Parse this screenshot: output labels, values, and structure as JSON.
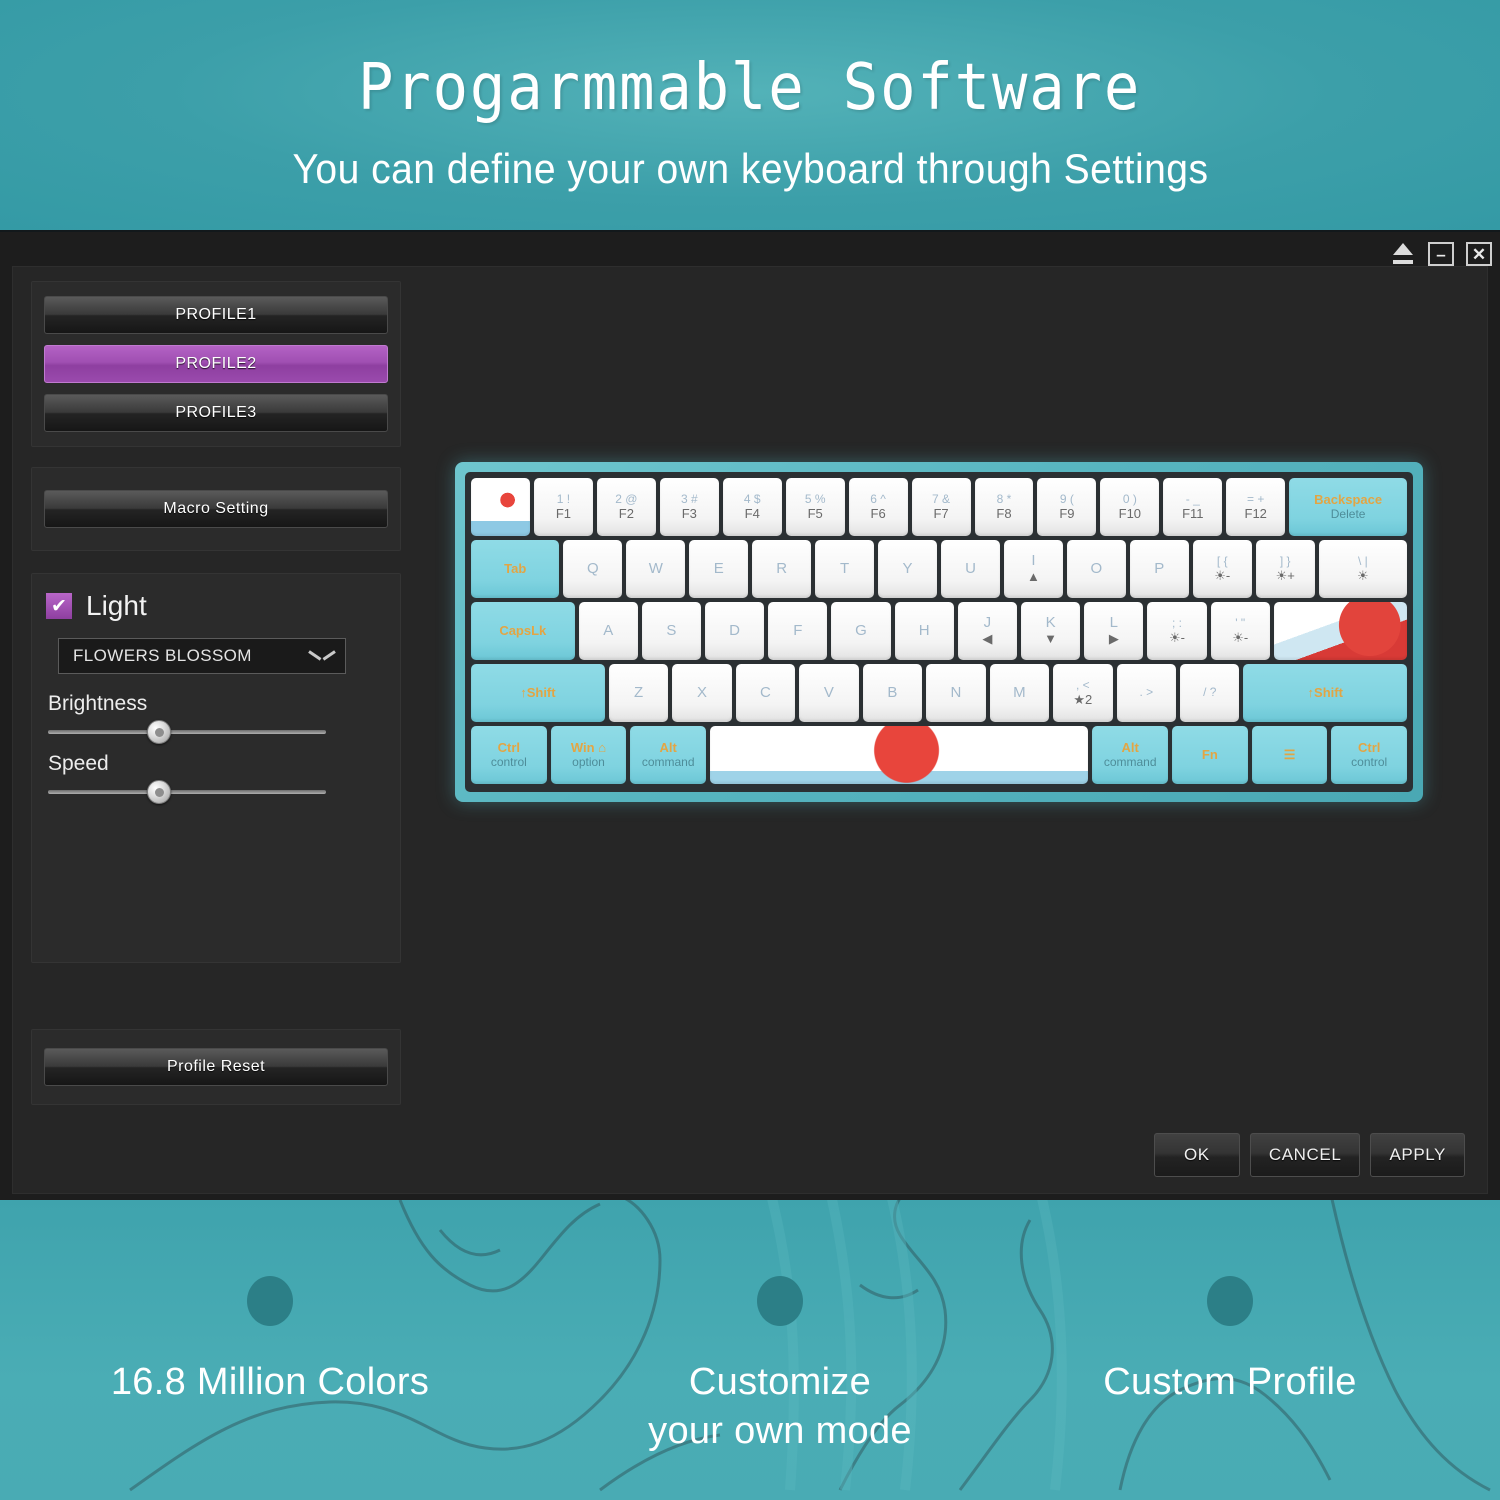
{
  "banner": {
    "title": "Progarmmable Software",
    "subtitle": "You can define your own keyboard through Settings"
  },
  "titlebar": {
    "eject_icon": "eject-icon",
    "minimize_label": "–",
    "close_label": "✕"
  },
  "sidebar": {
    "profiles": [
      {
        "label": "PROFILE1",
        "active": false
      },
      {
        "label": "PROFILE2",
        "active": true
      },
      {
        "label": "PROFILE3",
        "active": false
      }
    ],
    "macro_button": "Macro Setting",
    "light": {
      "checkbox_label": "Light",
      "checked": true,
      "checkmark": "✔",
      "effect_selected": "FLOWERS BLOSSOM",
      "brightness_label": "Brightness",
      "brightness_value": 40,
      "speed_label": "Speed",
      "speed_value": 40
    },
    "reset_button": "Profile Reset"
  },
  "footer": {
    "ok": "OK",
    "cancel": "CANCEL",
    "apply": "APPLY"
  },
  "keyboard": {
    "rows": [
      [
        {
          "top": "",
          "bot": "",
          "type": "art",
          "w": 1
        },
        {
          "top": "1 !",
          "bot": "F1",
          "w": 1
        },
        {
          "top": "2 @",
          "bot": "F2",
          "w": 1
        },
        {
          "top": "3 #",
          "bot": "F3",
          "w": 1
        },
        {
          "top": "4 $",
          "bot": "F4",
          "w": 1
        },
        {
          "top": "5 %",
          "bot": "F5",
          "w": 1
        },
        {
          "top": "6 ^",
          "bot": "F6",
          "w": 1
        },
        {
          "top": "7 &",
          "bot": "F7",
          "w": 1
        },
        {
          "top": "8 *",
          "bot": "F8",
          "w": 1
        },
        {
          "top": "9 (",
          "bot": "F9",
          "w": 1
        },
        {
          "top": "0 )",
          "bot": "F10",
          "w": 1
        },
        {
          "top": "- _",
          "bot": "F11",
          "w": 1
        },
        {
          "top": "= +",
          "bot": "F12",
          "w": 1
        },
        {
          "top": "Backspace",
          "bot": "Delete",
          "type": "cyan",
          "w": 2
        }
      ],
      [
        {
          "top": "Tab",
          "bot": "",
          "type": "cyan",
          "w": 1.5
        },
        {
          "top": "Q",
          "bot": "",
          "single": true,
          "w": 1
        },
        {
          "top": "W",
          "bot": "",
          "single": true,
          "w": 1
        },
        {
          "top": "E",
          "bot": "",
          "single": true,
          "w": 1
        },
        {
          "top": "R",
          "bot": "",
          "single": true,
          "w": 1
        },
        {
          "top": "T",
          "bot": "",
          "single": true,
          "w": 1
        },
        {
          "top": "Y",
          "bot": "",
          "single": true,
          "w": 1
        },
        {
          "top": "U",
          "bot": "",
          "single": true,
          "w": 1
        },
        {
          "top": "I",
          "bot": "▲",
          "single": true,
          "w": 1
        },
        {
          "top": "O",
          "bot": "",
          "single": true,
          "w": 1
        },
        {
          "top": "P",
          "bot": "",
          "single": true,
          "w": 1
        },
        {
          "top": "[ {",
          "bot": "☀-",
          "w": 1
        },
        {
          "top": "] }",
          "bot": "☀+",
          "w": 1
        },
        {
          "top": "\\ |",
          "bot": "☀",
          "w": 1.5
        }
      ],
      [
        {
          "top": "CapsLk",
          "bot": "",
          "type": "cyan",
          "w": 1.75
        },
        {
          "top": "A",
          "bot": "",
          "single": true,
          "w": 1
        },
        {
          "top": "S",
          "bot": "",
          "single": true,
          "w": 1
        },
        {
          "top": "D",
          "bot": "",
          "single": true,
          "w": 1
        },
        {
          "top": "F",
          "bot": "",
          "single": true,
          "w": 1
        },
        {
          "top": "G",
          "bot": "",
          "single": true,
          "w": 1
        },
        {
          "top": "H",
          "bot": "",
          "single": true,
          "w": 1
        },
        {
          "top": "J",
          "bot": "◀",
          "single": true,
          "w": 1
        },
        {
          "top": "K",
          "bot": "▼",
          "single": true,
          "w": 1
        },
        {
          "top": "L",
          "bot": "▶",
          "single": true,
          "w": 1
        },
        {
          "top": "; :",
          "bot": "☀-",
          "w": 1
        },
        {
          "top": "' \"",
          "bot": "☀-",
          "w": 1
        },
        {
          "top": "",
          "bot": "",
          "type": "art-wave",
          "w": 2.25
        }
      ],
      [
        {
          "top": "↑Shift",
          "bot": "",
          "type": "cyan",
          "w": 2.25
        },
        {
          "top": "Z",
          "bot": "",
          "single": true,
          "w": 1
        },
        {
          "top": "X",
          "bot": "",
          "single": true,
          "w": 1
        },
        {
          "top": "C",
          "bot": "",
          "single": true,
          "w": 1
        },
        {
          "top": "V",
          "bot": "",
          "single": true,
          "w": 1
        },
        {
          "top": "B",
          "bot": "",
          "single": true,
          "w": 1
        },
        {
          "top": "N",
          "bot": "",
          "single": true,
          "w": 1
        },
        {
          "top": "M",
          "bot": "",
          "single": true,
          "w": 1
        },
        {
          "top": ", <",
          "bot": "★2",
          "w": 1
        },
        {
          "top": ". >",
          "bot": "",
          "w": 1
        },
        {
          "top": "/ ?",
          "bot": "",
          "w": 1
        },
        {
          "top": "↑Shift",
          "bot": "",
          "type": "cyan",
          "w": 2.75
        }
      ],
      [
        {
          "top": "Ctrl",
          "bot": "control",
          "type": "cyan",
          "w": 1.25
        },
        {
          "top": "Win ⌂",
          "bot": "option",
          "type": "cyan",
          "w": 1.25
        },
        {
          "top": "Alt",
          "bot": "command",
          "type": "cyan",
          "w": 1.25
        },
        {
          "top": "",
          "bot": "",
          "type": "space",
          "w": 6.25
        },
        {
          "top": "Alt",
          "bot": "command",
          "type": "cyan",
          "w": 1.25
        },
        {
          "top": "Fn",
          "bot": "",
          "type": "cyan",
          "w": 1.25
        },
        {
          "top": "☰",
          "bot": "",
          "type": "cyan",
          "w": 1.25
        },
        {
          "top": "Ctrl",
          "bot": "control",
          "type": "cyan",
          "w": 1.25
        }
      ]
    ]
  },
  "features": [
    {
      "label": "16.8 Million Colors"
    },
    {
      "label": "Customize\nyour own mode"
    },
    {
      "label": "Custom Profile"
    }
  ],
  "colors": {
    "teal": "#3fa3ad",
    "dark_bg": "#262626",
    "accent_purple": "#8e3fa0",
    "key_cyan": "#7fd3e0"
  }
}
